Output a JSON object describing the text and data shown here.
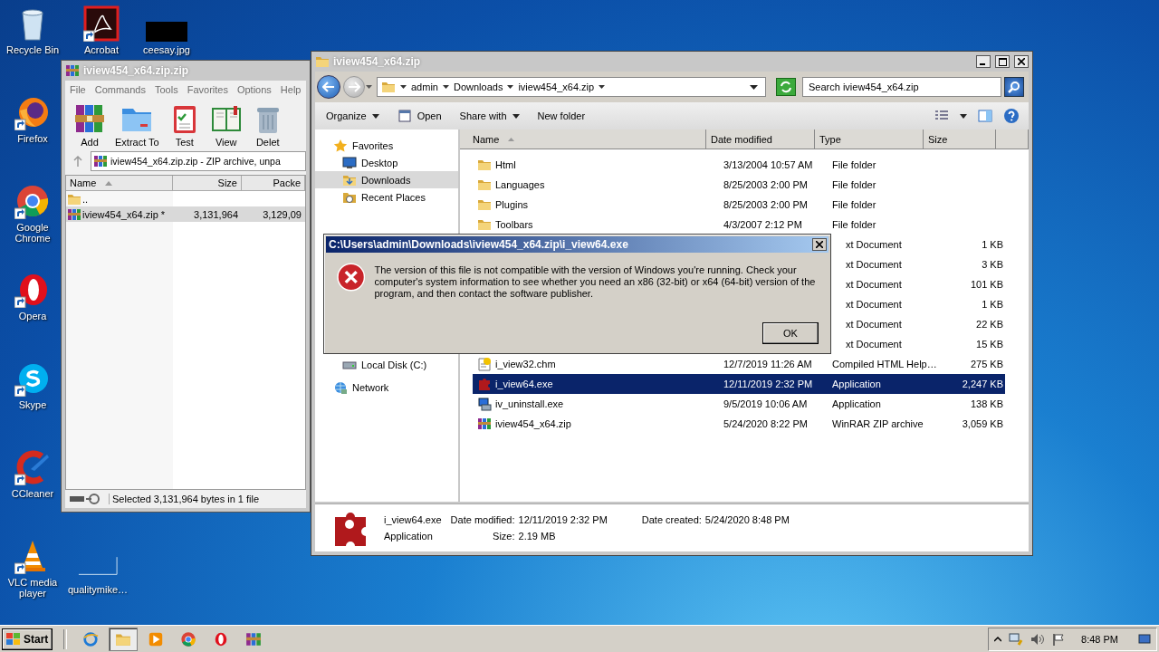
{
  "desktop_icons": [
    {
      "label": "Recycle Bin",
      "kind": "bin",
      "shortcut": false
    },
    {
      "label": "Firefox",
      "kind": "fox",
      "shortcut": true
    },
    {
      "label": "Google Chrome",
      "kind": "chrome",
      "shortcut": true
    },
    {
      "label": "Opera",
      "kind": "opera",
      "shortcut": true
    },
    {
      "label": "Skype",
      "kind": "skype",
      "shortcut": true
    },
    {
      "label": "CCleaner",
      "kind": "cleaner",
      "shortcut": true
    },
    {
      "label": "VLC media player",
      "kind": "cone",
      "shortcut": true
    }
  ],
  "desktop_extra_icons": [
    {
      "label": "Acrobat",
      "kind": "pdf",
      "shortcut": true
    },
    {
      "label": "ceesay.jpg",
      "kind": "thumbnail",
      "shortcut": false
    },
    {
      "label": "qualitymike…",
      "kind": "blank",
      "shortcut": false
    }
  ],
  "archiver": {
    "title": "iview454_x64.zip.zip",
    "menu": [
      "File",
      "Commands",
      "Tools",
      "Favorites",
      "Options",
      "Help"
    ],
    "toolbar": [
      {
        "label": "Add",
        "kind": "books"
      },
      {
        "label": "Extract To",
        "kind": "folder"
      },
      {
        "label": "Test",
        "kind": "clipboard"
      },
      {
        "label": "View",
        "kind": "book"
      },
      {
        "label": "Delet",
        "kind": "trash"
      }
    ],
    "address": "iview454_x64.zip.zip - ZIP archive, unpa",
    "columns": [
      "Name",
      "Size",
      "Packe"
    ],
    "rows": [
      {
        "name": "..",
        "size": "",
        "packed": "",
        "kind": "folder",
        "selected": false
      },
      {
        "name": "iview454_x64.zip *",
        "size": "3,131,964",
        "packed": "3,129,09",
        "kind": "archive",
        "selected": true
      }
    ],
    "status": "Selected 3,131,964 bytes in 1 file"
  },
  "explorer": {
    "title": "iview454_x64.zip",
    "breadcrumb": [
      "admin",
      "Downloads",
      "iview454_x64.zip"
    ],
    "search": {
      "placeholder": "Search iview454_x64.zip"
    },
    "commands": [
      {
        "label": "Organize",
        "kind": "menu"
      },
      {
        "label": "Open",
        "kind": "open"
      },
      {
        "label": "Share with",
        "kind": "menu"
      },
      {
        "label": "New folder",
        "kind": "plain"
      }
    ],
    "nav": [
      {
        "label": "Favorites",
        "kind": "star",
        "selected": false,
        "children": [
          {
            "label": "Desktop",
            "kind": "desktop",
            "selected": false
          },
          {
            "label": "Downloads",
            "kind": "downloads",
            "selected": true
          },
          {
            "label": "Recent Places",
            "kind": "recent",
            "selected": false
          }
        ]
      },
      {
        "label": "Local Disk (C:)",
        "kind": "drive",
        "selected": false
      },
      {
        "label": "Network",
        "kind": "network",
        "selected": false
      }
    ],
    "columns": [
      "Name",
      "Date modified",
      "Type",
      "Size"
    ],
    "rows": [
      {
        "name": "Html",
        "date": "3/13/2004 10:57 AM",
        "type": "File folder",
        "size": "",
        "kind": "folder",
        "selected": false
      },
      {
        "name": "Languages",
        "date": "8/25/2003 2:00 PM",
        "type": "File folder",
        "size": "",
        "kind": "folder",
        "selected": false
      },
      {
        "name": "Plugins",
        "date": "8/25/2003 2:00 PM",
        "type": "File folder",
        "size": "",
        "kind": "folder",
        "selected": false
      },
      {
        "name": "Toolbars",
        "date": "4/3/2007 2:12 PM",
        "type": "File folder",
        "size": "",
        "kind": "folder",
        "selected": false
      },
      {
        "name": "",
        "date": "",
        "type": "xt Document",
        "size": "1 KB",
        "kind": "covered",
        "selected": false
      },
      {
        "name": "",
        "date": "",
        "type": "xt Document",
        "size": "3 KB",
        "kind": "covered",
        "selected": false
      },
      {
        "name": "",
        "date": "",
        "type": "xt Document",
        "size": "101 KB",
        "kind": "covered",
        "selected": false
      },
      {
        "name": "",
        "date": "",
        "type": "xt Document",
        "size": "1 KB",
        "kind": "covered",
        "selected": false
      },
      {
        "name": "",
        "date": "",
        "type": "xt Document",
        "size": "22 KB",
        "kind": "covered",
        "selected": false
      },
      {
        "name": "",
        "date": "",
        "type": "xt Document",
        "size": "15 KB",
        "kind": "covered",
        "selected": false
      },
      {
        "name": "i_view32.chm",
        "date": "12/7/2019 11:26 AM",
        "type": "Compiled HTML Help…",
        "size": "275 KB",
        "kind": "help",
        "selected": false
      },
      {
        "name": "i_view64.exe",
        "date": "12/11/2019 2:32 PM",
        "type": "Application",
        "size": "2,247 KB",
        "kind": "app",
        "selected": true
      },
      {
        "name": "iv_uninstall.exe",
        "date": "9/5/2019 10:06 AM",
        "type": "Application",
        "size": "138 KB",
        "kind": "setup",
        "selected": false
      },
      {
        "name": "iview454_x64.zip",
        "date": "5/24/2020 8:22 PM",
        "type": "WinRAR ZIP archive",
        "size": "3,059 KB",
        "kind": "archive",
        "selected": false
      }
    ],
    "details": {
      "name": "i_view64.exe",
      "type": "Application",
      "fields": [
        {
          "label": "Date modified:",
          "value": "12/11/2019 2:32 PM"
        },
        {
          "label": "Size:",
          "value": "2.19 MB"
        },
        {
          "label": "Date created:",
          "value": "5/24/2020 8:48 PM"
        }
      ]
    }
  },
  "dialog": {
    "title": "C:\\Users\\admin\\Downloads\\iview454_x64.zip\\i_view64.exe",
    "message": "The version of this file is not compatible with the version of Windows you're running. Check your computer's system information to see whether you need an x86 (32-bit) or x64 (64-bit) version of the program, and then contact the software publisher.",
    "button": "OK"
  },
  "taskbar": {
    "start": "Start",
    "apps": [
      {
        "kind": "globe",
        "active": false
      },
      {
        "kind": "folder",
        "active": true
      },
      {
        "kind": "media",
        "active": false
      },
      {
        "kind": "chrome",
        "active": false
      },
      {
        "kind": "opera",
        "active": false
      },
      {
        "kind": "books",
        "active": false
      }
    ],
    "clock": "8:48 PM"
  }
}
